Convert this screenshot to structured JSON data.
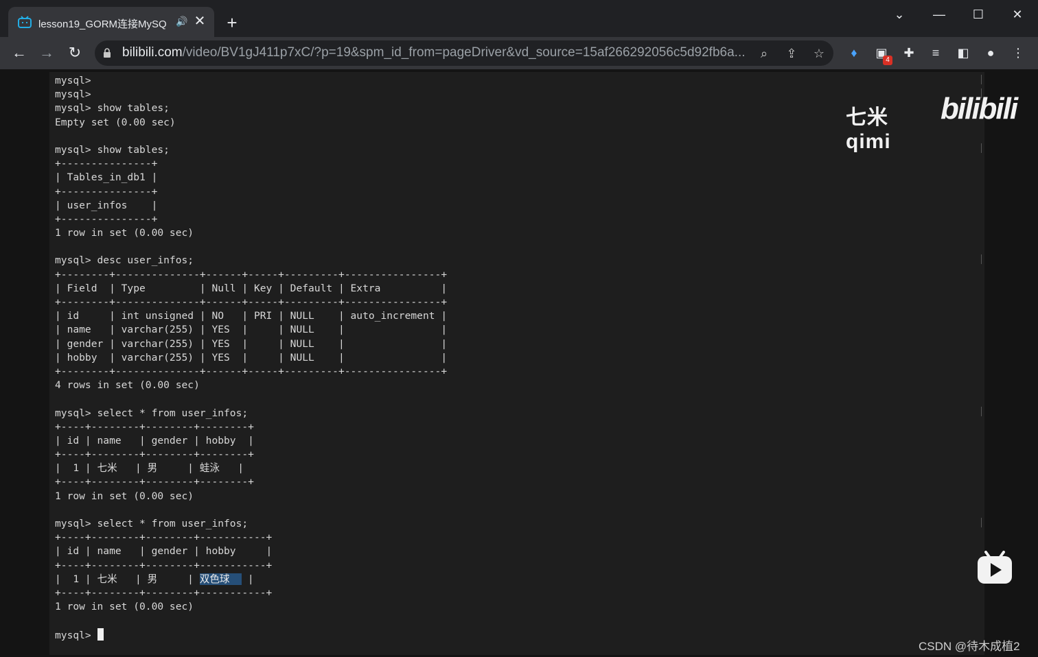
{
  "browser": {
    "tab": {
      "title": "lesson19_GORM连接MySQ"
    },
    "address": {
      "host": "bilibili.com",
      "path": "/video/BV1gJ411p7xC/?p=19&spm_id_from=pageDriver&vd_source=15af266292056c5d92fb6a..."
    },
    "extension_badge": "4"
  },
  "terminal": {
    "lines": [
      "mysql>",
      "mysql>",
      "mysql> show tables;",
      "Empty set (0.00 sec)",
      "",
      "mysql> show tables;",
      "+---------------+",
      "| Tables_in_db1 |",
      "+---------------+",
      "| user_infos    |",
      "+---------------+",
      "1 row in set (0.00 sec)",
      "",
      "mysql> desc user_infos;",
      "+--------+--------------+------+-----+---------+----------------+",
      "| Field  | Type         | Null | Key | Default | Extra          |",
      "+--------+--------------+------+-----+---------+----------------+",
      "| id     | int unsigned | NO   | PRI | NULL    | auto_increment |",
      "| name   | varchar(255) | YES  |     | NULL    |                |",
      "| gender | varchar(255) | YES  |     | NULL    |                |",
      "| hobby  | varchar(255) | YES  |     | NULL    |                |",
      "+--------+--------------+------+-----+---------+----------------+",
      "4 rows in set (0.00 sec)",
      "",
      "mysql> select * from user_infos;",
      "+----+--------+--------+--------+",
      "| id | name   | gender | hobby  |",
      "+----+--------+--------+--------+",
      "|  1 | 七米   | 男     | 蛙泳   |",
      "+----+--------+--------+--------+",
      "1 row in set (0.00 sec)",
      "",
      "mysql> select * from user_infos;",
      "+----+--------+--------+-----------+",
      "| id | name   | gender | hobby     |",
      "+----+--------+--------+-----------+",
      "|  1 | 七米   | 男     | ",
      "+----+--------+--------+-----------+",
      "1 row in set (0.00 sec)",
      "",
      "mysql> "
    ],
    "selected_text": "双色球  ",
    "selected_line_tail": " |"
  },
  "overlay": {
    "watermark_text": "七米qimi",
    "watermark_logo": "bilibili",
    "credit": "CSDN @待木成植2"
  }
}
